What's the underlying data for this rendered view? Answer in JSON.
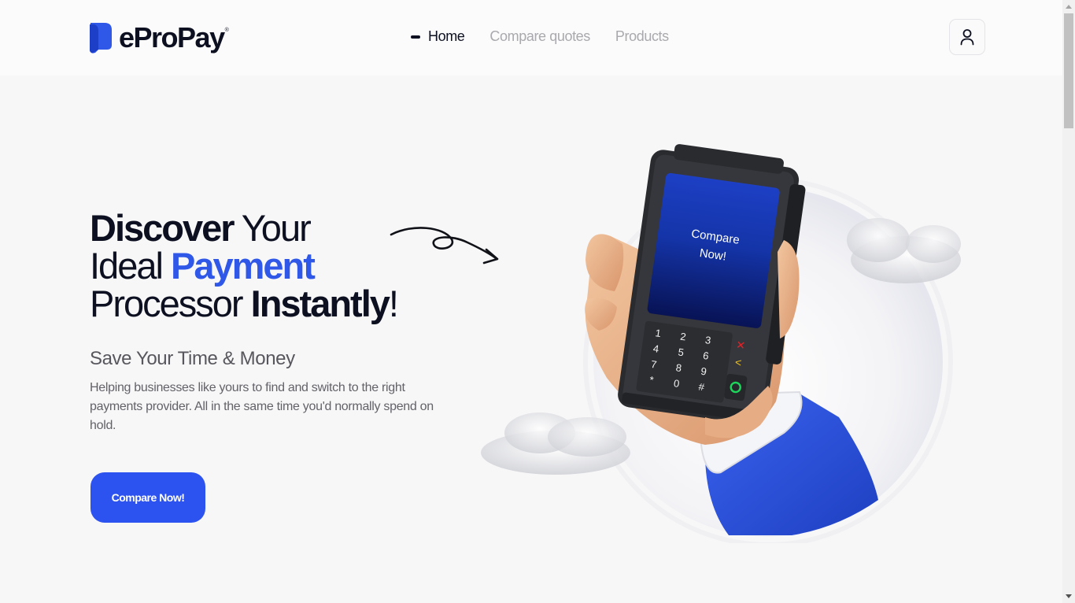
{
  "app": {
    "logo_text": "eProPay",
    "logo_trademark": "®",
    "brand_color": "#2f57e8"
  },
  "nav": {
    "items": [
      {
        "label": "Home",
        "active": true
      },
      {
        "label": "Compare quotes",
        "active": false
      },
      {
        "label": "Products",
        "active": false
      }
    ]
  },
  "header": {
    "user_icon": "user-icon"
  },
  "hero": {
    "title_line1_bold": "Discover",
    "title_line1_rest": " Your",
    "title_line2_plain": "Ideal ",
    "title_line2_accent": "Payment",
    "title_line3_plain": "Processor ",
    "title_line3_bold": "Instantly",
    "title_line3_end": "!",
    "subtitle": "Save Your Time & Money",
    "description": "Helping businesses like yours to find and switch to the right payments provider. All in the same time you'd normally spend on hold.",
    "cta_label": "Compare Now!",
    "accent_color": "#2f57e8",
    "cta_color": "#2c53ef"
  },
  "illustration": {
    "screen_text_line1": "Compare",
    "screen_text_line2": "Now!",
    "keypad": [
      "1",
      "2",
      "3",
      "4",
      "5",
      "6",
      "7",
      "8",
      "9",
      "*",
      "0",
      "#"
    ],
    "icons": [
      "hand-icon",
      "card-terminal-icon",
      "cloud-icon"
    ]
  }
}
